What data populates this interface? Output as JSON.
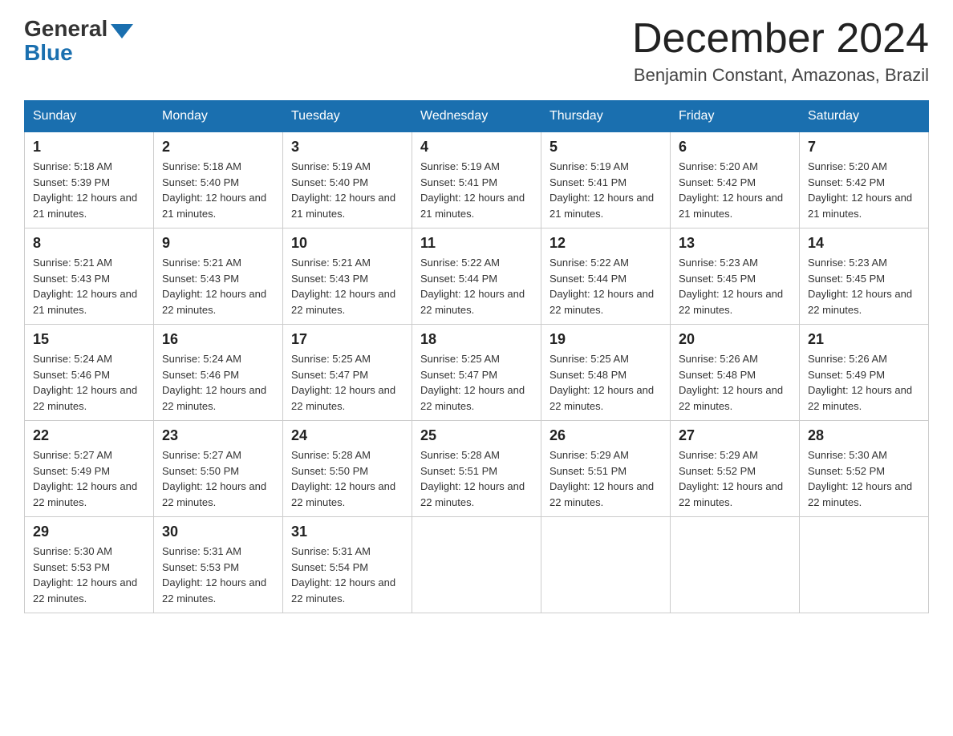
{
  "header": {
    "logo_general": "General",
    "logo_blue": "Blue",
    "month_title": "December 2024",
    "location": "Benjamin Constant, Amazonas, Brazil"
  },
  "days_of_week": [
    "Sunday",
    "Monday",
    "Tuesday",
    "Wednesday",
    "Thursday",
    "Friday",
    "Saturday"
  ],
  "weeks": [
    [
      {
        "day": "1",
        "sunrise": "5:18 AM",
        "sunset": "5:39 PM",
        "daylight": "12 hours and 21 minutes."
      },
      {
        "day": "2",
        "sunrise": "5:18 AM",
        "sunset": "5:40 PM",
        "daylight": "12 hours and 21 minutes."
      },
      {
        "day": "3",
        "sunrise": "5:19 AM",
        "sunset": "5:40 PM",
        "daylight": "12 hours and 21 minutes."
      },
      {
        "day": "4",
        "sunrise": "5:19 AM",
        "sunset": "5:41 PM",
        "daylight": "12 hours and 21 minutes."
      },
      {
        "day": "5",
        "sunrise": "5:19 AM",
        "sunset": "5:41 PM",
        "daylight": "12 hours and 21 minutes."
      },
      {
        "day": "6",
        "sunrise": "5:20 AM",
        "sunset": "5:42 PM",
        "daylight": "12 hours and 21 minutes."
      },
      {
        "day": "7",
        "sunrise": "5:20 AM",
        "sunset": "5:42 PM",
        "daylight": "12 hours and 21 minutes."
      }
    ],
    [
      {
        "day": "8",
        "sunrise": "5:21 AM",
        "sunset": "5:43 PM",
        "daylight": "12 hours and 21 minutes."
      },
      {
        "day": "9",
        "sunrise": "5:21 AM",
        "sunset": "5:43 PM",
        "daylight": "12 hours and 22 minutes."
      },
      {
        "day": "10",
        "sunrise": "5:21 AM",
        "sunset": "5:43 PM",
        "daylight": "12 hours and 22 minutes."
      },
      {
        "day": "11",
        "sunrise": "5:22 AM",
        "sunset": "5:44 PM",
        "daylight": "12 hours and 22 minutes."
      },
      {
        "day": "12",
        "sunrise": "5:22 AM",
        "sunset": "5:44 PM",
        "daylight": "12 hours and 22 minutes."
      },
      {
        "day": "13",
        "sunrise": "5:23 AM",
        "sunset": "5:45 PM",
        "daylight": "12 hours and 22 minutes."
      },
      {
        "day": "14",
        "sunrise": "5:23 AM",
        "sunset": "5:45 PM",
        "daylight": "12 hours and 22 minutes."
      }
    ],
    [
      {
        "day": "15",
        "sunrise": "5:24 AM",
        "sunset": "5:46 PM",
        "daylight": "12 hours and 22 minutes."
      },
      {
        "day": "16",
        "sunrise": "5:24 AM",
        "sunset": "5:46 PM",
        "daylight": "12 hours and 22 minutes."
      },
      {
        "day": "17",
        "sunrise": "5:25 AM",
        "sunset": "5:47 PM",
        "daylight": "12 hours and 22 minutes."
      },
      {
        "day": "18",
        "sunrise": "5:25 AM",
        "sunset": "5:47 PM",
        "daylight": "12 hours and 22 minutes."
      },
      {
        "day": "19",
        "sunrise": "5:25 AM",
        "sunset": "5:48 PM",
        "daylight": "12 hours and 22 minutes."
      },
      {
        "day": "20",
        "sunrise": "5:26 AM",
        "sunset": "5:48 PM",
        "daylight": "12 hours and 22 minutes."
      },
      {
        "day": "21",
        "sunrise": "5:26 AM",
        "sunset": "5:49 PM",
        "daylight": "12 hours and 22 minutes."
      }
    ],
    [
      {
        "day": "22",
        "sunrise": "5:27 AM",
        "sunset": "5:49 PM",
        "daylight": "12 hours and 22 minutes."
      },
      {
        "day": "23",
        "sunrise": "5:27 AM",
        "sunset": "5:50 PM",
        "daylight": "12 hours and 22 minutes."
      },
      {
        "day": "24",
        "sunrise": "5:28 AM",
        "sunset": "5:50 PM",
        "daylight": "12 hours and 22 minutes."
      },
      {
        "day": "25",
        "sunrise": "5:28 AM",
        "sunset": "5:51 PM",
        "daylight": "12 hours and 22 minutes."
      },
      {
        "day": "26",
        "sunrise": "5:29 AM",
        "sunset": "5:51 PM",
        "daylight": "12 hours and 22 minutes."
      },
      {
        "day": "27",
        "sunrise": "5:29 AM",
        "sunset": "5:52 PM",
        "daylight": "12 hours and 22 minutes."
      },
      {
        "day": "28",
        "sunrise": "5:30 AM",
        "sunset": "5:52 PM",
        "daylight": "12 hours and 22 minutes."
      }
    ],
    [
      {
        "day": "29",
        "sunrise": "5:30 AM",
        "sunset": "5:53 PM",
        "daylight": "12 hours and 22 minutes."
      },
      {
        "day": "30",
        "sunrise": "5:31 AM",
        "sunset": "5:53 PM",
        "daylight": "12 hours and 22 minutes."
      },
      {
        "day": "31",
        "sunrise": "5:31 AM",
        "sunset": "5:54 PM",
        "daylight": "12 hours and 22 minutes."
      },
      null,
      null,
      null,
      null
    ]
  ],
  "labels": {
    "sunrise_prefix": "Sunrise: ",
    "sunset_prefix": "Sunset: ",
    "daylight_prefix": "Daylight: "
  }
}
